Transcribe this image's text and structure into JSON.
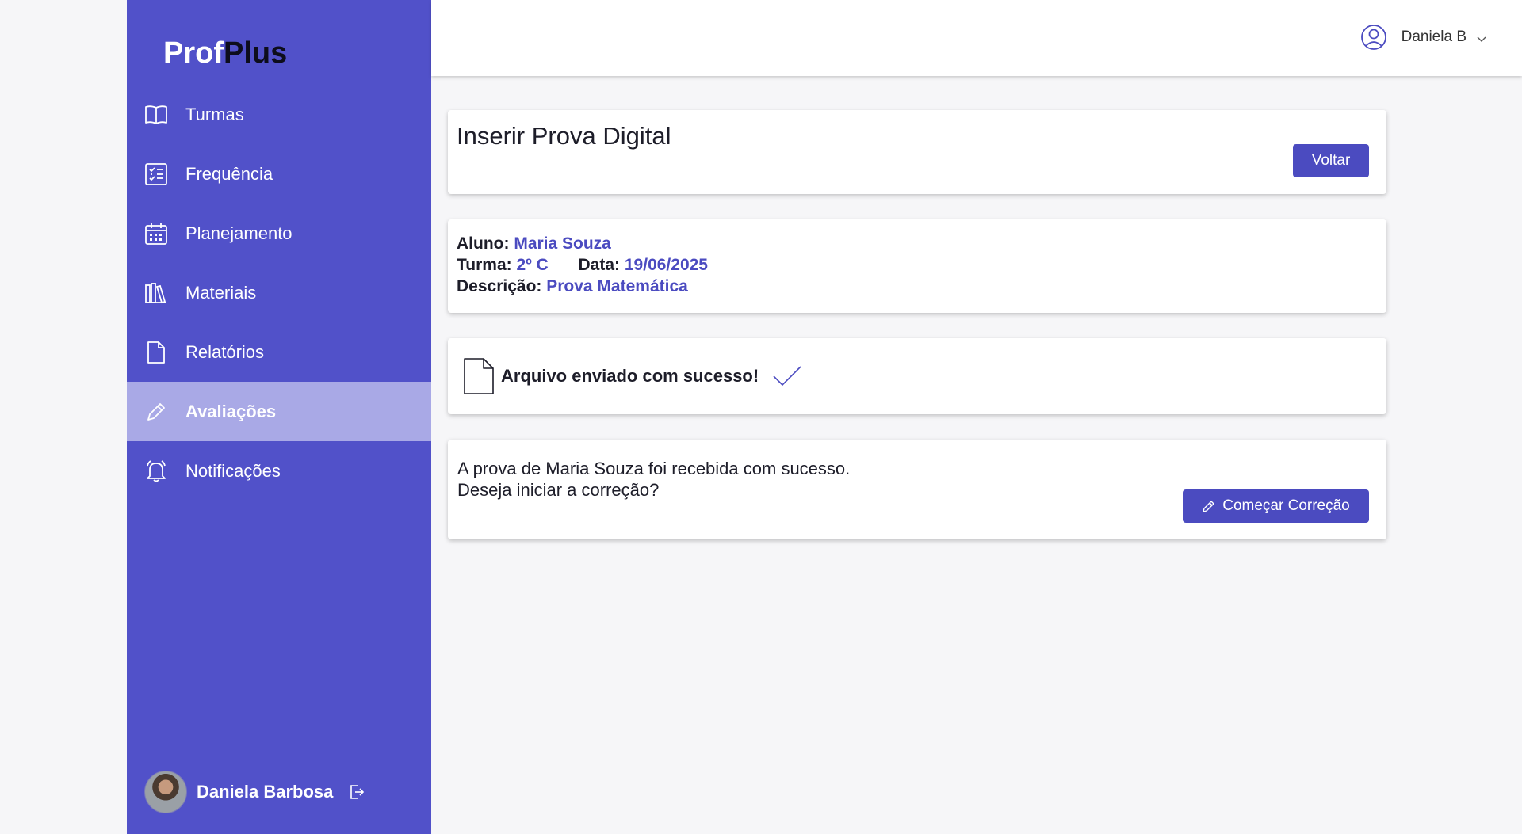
{
  "app": {
    "logo_part1": "Prof",
    "logo_part2": "Plus"
  },
  "sidebar": {
    "items": [
      {
        "label": "Turmas",
        "icon": "book-icon"
      },
      {
        "label": "Frequência",
        "icon": "checklist-icon"
      },
      {
        "label": "Planejamento",
        "icon": "calendar-icon"
      },
      {
        "label": "Materiais",
        "icon": "library-icon"
      },
      {
        "label": "Relatórios",
        "icon": "document-icon"
      },
      {
        "label": "Avaliações",
        "icon": "pencil-icon",
        "active": true
      },
      {
        "label": "Notificações",
        "icon": "bell-icon"
      }
    ],
    "user_name": "Daniela Barbosa"
  },
  "header": {
    "user_short": "Daniela B"
  },
  "page": {
    "title": "Inserir Prova Digital",
    "back_label": "Voltar"
  },
  "student_info": {
    "aluno_label": "Aluno:",
    "aluno_value": "Maria Souza",
    "turma_label": "Turma:",
    "turma_value": "2º C",
    "data_label": "Data:",
    "data_value": "19/06/2025",
    "descricao_label": "Descrição:",
    "descricao_value": "Prova Matemática"
  },
  "upload": {
    "message": "Arquivo enviado com sucesso!"
  },
  "confirm": {
    "line1": "A prova de Maria Souza foi recebida com sucesso.",
    "line2": "Deseja iniciar a correção?",
    "start_label": "Começar Correção"
  },
  "colors": {
    "sidebar_bg": "#5151c9",
    "active_bg": "#a9a9e6",
    "accent": "#4b4bc0"
  }
}
